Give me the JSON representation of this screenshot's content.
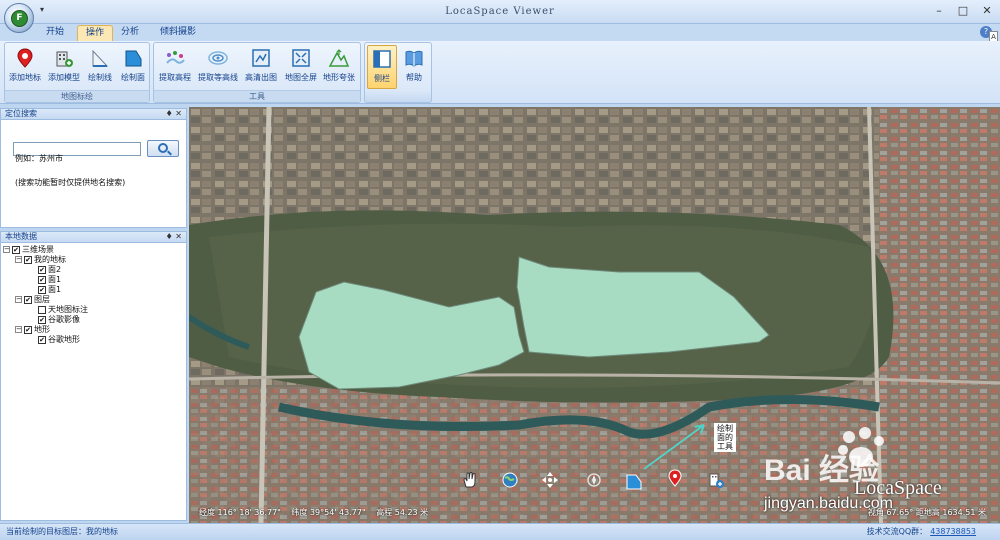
{
  "window": {
    "title": "LocaSpace Viewer",
    "app_icon_letter": "F",
    "qat_glyph": "▾"
  },
  "window_controls": {
    "minimize": "–",
    "restore": "□",
    "close": "✕"
  },
  "tabs": [
    {
      "label": "开始"
    },
    {
      "label": "操作"
    },
    {
      "label": "分析"
    },
    {
      "label": "倾斜摄影"
    }
  ],
  "active_tab": "操作",
  "help_glyph": "?",
  "side_glyph": "A",
  "ribbon": {
    "groups": [
      {
        "label": "地图标绘",
        "buttons": [
          "添加地标",
          "添加模型",
          "绘制线",
          "绘制面"
        ]
      },
      {
        "label": "工具",
        "buttons": [
          "提取高程",
          "提取等高线",
          "高清出图",
          "地图全屏",
          "地形夸张"
        ]
      },
      {
        "label": "",
        "buttons": [
          "侧栏",
          "帮助"
        ]
      }
    ]
  },
  "search_panel": {
    "title": "定位搜索",
    "pin_glyph": "♦",
    "close_glyph": "✕",
    "input_value": "",
    "example": "例如：苏州市",
    "note": "(搜索功能暂时仅提供地名搜索)"
  },
  "data_panel": {
    "title": "本地数据",
    "pin_glyph": "♦",
    "close_glyph": "✕",
    "expander_glyph": "−",
    "check_glyph": "✔",
    "tree": [
      {
        "label": "三维场景",
        "level": 0,
        "checked": true,
        "expander": true
      },
      {
        "label": "我的地标",
        "level": 1,
        "checked": true,
        "expander": true
      },
      {
        "label": "面2",
        "level": 2,
        "checked": true,
        "expander": false
      },
      {
        "label": "面1",
        "level": 2,
        "checked": true,
        "expander": false
      },
      {
        "label": "面1",
        "level": 2,
        "checked": true,
        "expander": false
      },
      {
        "label": "图层",
        "level": 1,
        "checked": true,
        "expander": true
      },
      {
        "label": "天地图标注",
        "level": 2,
        "checked": false,
        "expander": false
      },
      {
        "label": "谷歌影像",
        "level": 2,
        "checked": true,
        "expander": false
      },
      {
        "label": "地形",
        "level": 1,
        "checked": true,
        "expander": true
      },
      {
        "label": "谷歌地形",
        "level": 2,
        "checked": true,
        "expander": false
      }
    ]
  },
  "map": {
    "hud": {
      "longitude": "经度 116° 18' 36.77\"",
      "latitude": "纬度 39°54' 43.77\"",
      "elevation": "高程 54.23 米",
      "eye_height": "视角 67.65° 距地高 1634.51 米"
    },
    "tooltip": "绘制面的工具",
    "polygon_color": "#a8dcc2",
    "watermark": {
      "brand": "Bai 经验",
      "site": "jingyan.baidu.com",
      "product": "LocaSpace",
      "url": "jingyan.baidu.com"
    }
  },
  "statusbar": {
    "left": "当前绘制的目标图层：我的地标",
    "right_label": "技术交流QQ群：",
    "right_link": "438738853"
  },
  "colors": {
    "ribbon_bg": "#dbe8f8",
    "accent": "#fbe8b4",
    "panel_border": "#9ebbe0"
  }
}
